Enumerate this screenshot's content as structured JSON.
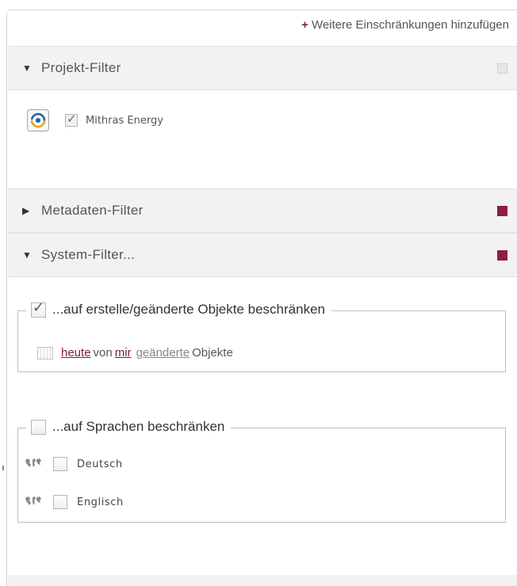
{
  "topbar": {
    "plus": "+",
    "add_label": "Weitere Einschränkungen hinzufügen"
  },
  "sections": {
    "project": {
      "arrow": "▼",
      "title": "Projekt-Filter"
    },
    "metadata": {
      "arrow": "▶",
      "title": "Metadaten-Filter"
    },
    "system": {
      "arrow": "▼",
      "title": "System-Filter..."
    }
  },
  "project_filter": {
    "item_label": "Mithras Energy",
    "checked": true
  },
  "changed_objects": {
    "legend": "...auf erstelle/geänderte Objekte beschränken",
    "checked": true,
    "when": "heute",
    "by_prefix": "von",
    "who": "mir",
    "action": "geänderte",
    "suffix": "Objekte"
  },
  "languages": {
    "legend": "...auf Sprachen beschränken",
    "checked": false,
    "items": [
      {
        "label": "Deutsch",
        "checked": false
      },
      {
        "label": "Englisch",
        "checked": false
      }
    ]
  },
  "colors": {
    "accent": "#8b1e45",
    "inactive_square": "#e6e6e6"
  }
}
